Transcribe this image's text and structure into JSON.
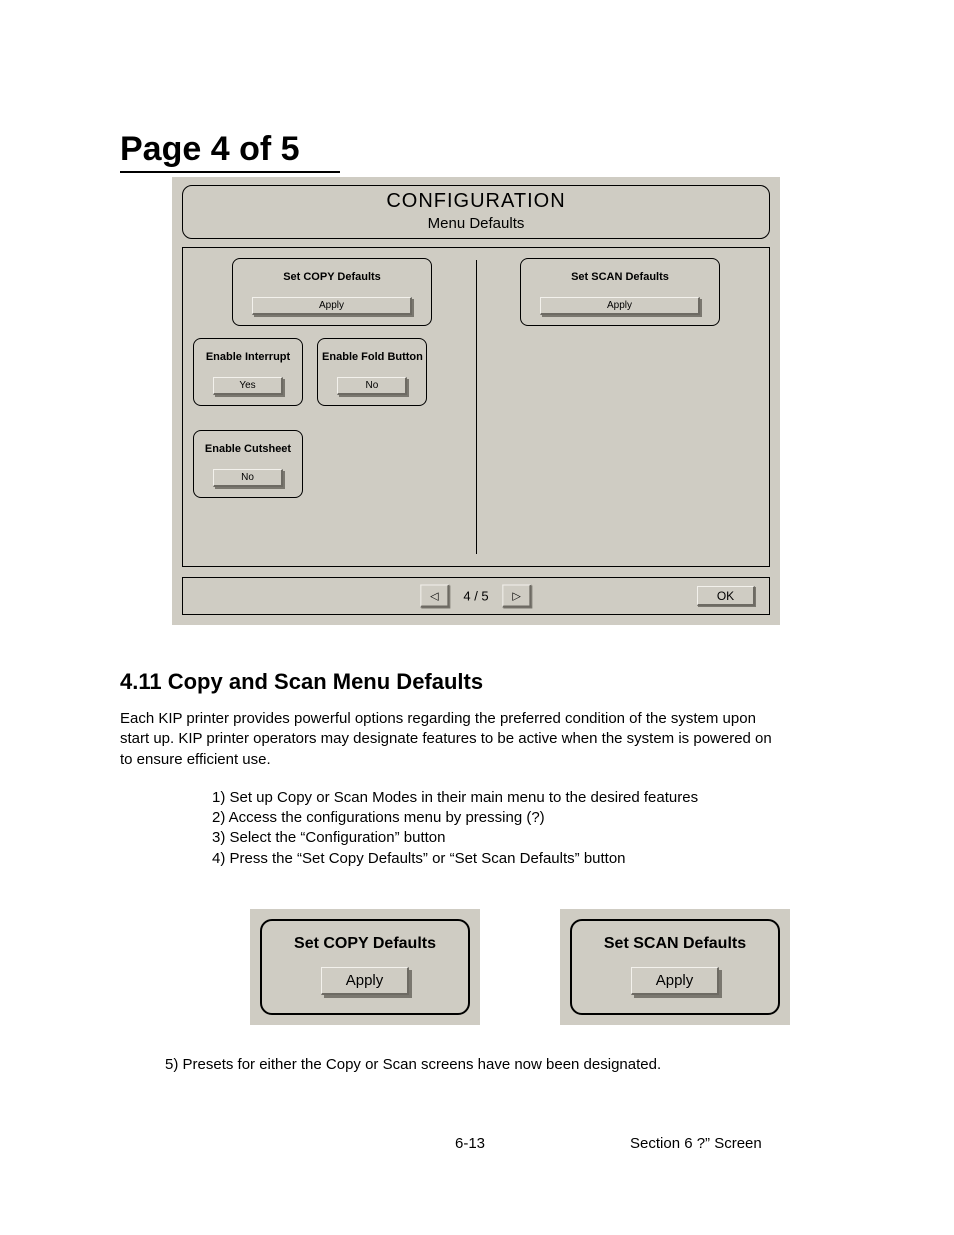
{
  "page_title": "Page 4 of 5",
  "figure": {
    "header_title": "CONFIGURATION",
    "header_subtitle": "Menu Defaults",
    "copy_defaults": {
      "title": "Set COPY Defaults",
      "button": "Apply"
    },
    "scan_defaults": {
      "title": "Set SCAN Defaults",
      "button": "Apply"
    },
    "enable_interrupt": {
      "title": "Enable Interrupt",
      "button": "Yes"
    },
    "enable_fold": {
      "title": "Enable Fold Button",
      "button": "No"
    },
    "enable_cutsheet": {
      "title": "Enable Cutsheet",
      "button": "No"
    },
    "page_indicator": "4 / 5",
    "prev_glyph": "◁",
    "next_glyph": "▷",
    "ok": "OK"
  },
  "section_heading": "4.11 Copy and Scan Menu Defaults",
  "paragraph": "Each KIP printer provides powerful options regarding the preferred condition of the system upon start up.  KIP printer operators may designate features to be active when the system is powered on to ensure efficient use.",
  "steps": {
    "s1": "1)  Set up Copy or Scan Modes in their main menu to the desired features",
    "s2": "2)  Access the configurations menu by pressing (?)",
    "s3": "3)  Select the “Configuration” button",
    "s4": "4)  Press the “Set Copy Defaults” or “Set Scan Defaults” button"
  },
  "big_panels": {
    "copy": {
      "title": "Set COPY Defaults",
      "button": "Apply"
    },
    "scan": {
      "title": "Set SCAN Defaults",
      "button": "Apply"
    }
  },
  "step5": "5)  Presets for either the Copy or Scan screens have now been designated.",
  "footer": {
    "page_number": "6-13",
    "section": "Section 6    ?” Screen"
  }
}
